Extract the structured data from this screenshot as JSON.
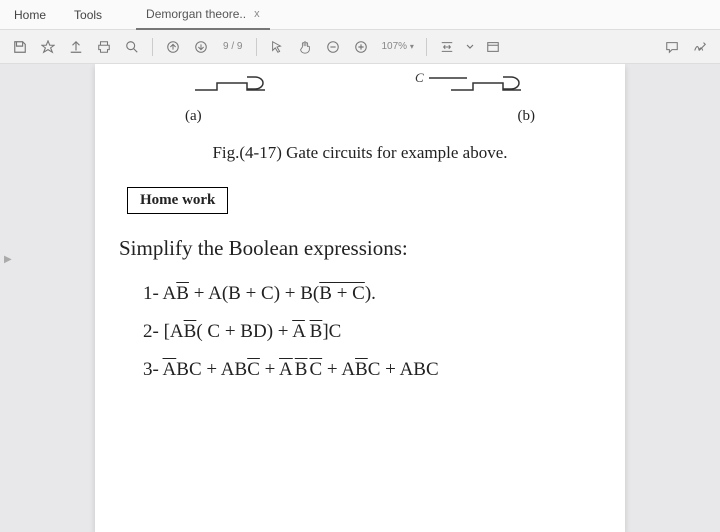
{
  "menu": {
    "home": "Home",
    "tools": "Tools"
  },
  "tab": {
    "title": "Demorgan theore..",
    "close": "x"
  },
  "toolbar": {
    "page_current": "9",
    "page_sep": "/",
    "page_total": "9",
    "zoom": "107%"
  },
  "doc": {
    "label_a": "(a)",
    "label_b": "(b)",
    "caption": "Fig.(4-17) Gate circuits for example above.",
    "hw_title": "Home work",
    "heading": "Simplify the Boolean expressions:"
  },
  "expr": {
    "n1a": "1-  A",
    "n1b": "B",
    "n1c": " + A(B + C) + B(",
    "n1d": "B + C",
    "n1e": ").",
    "n2a": "2-  [A",
    "n2b": "B",
    "n2c": "( C + BD) + ",
    "n2d": "A",
    "n2e": " ",
    "n2f": "B",
    "n2g": "]C",
    "n3a": "3-  ",
    "n3b": "A",
    "n3c": "BC + AB",
    "n3d": "C",
    "n3e": " + ",
    "n3f": "A",
    "n3g": " ",
    "n3h": "B",
    "n3i": " ",
    "n3j": "C",
    "n3k": " + A",
    "n3l": "B",
    "n3m": "C + ABC"
  }
}
